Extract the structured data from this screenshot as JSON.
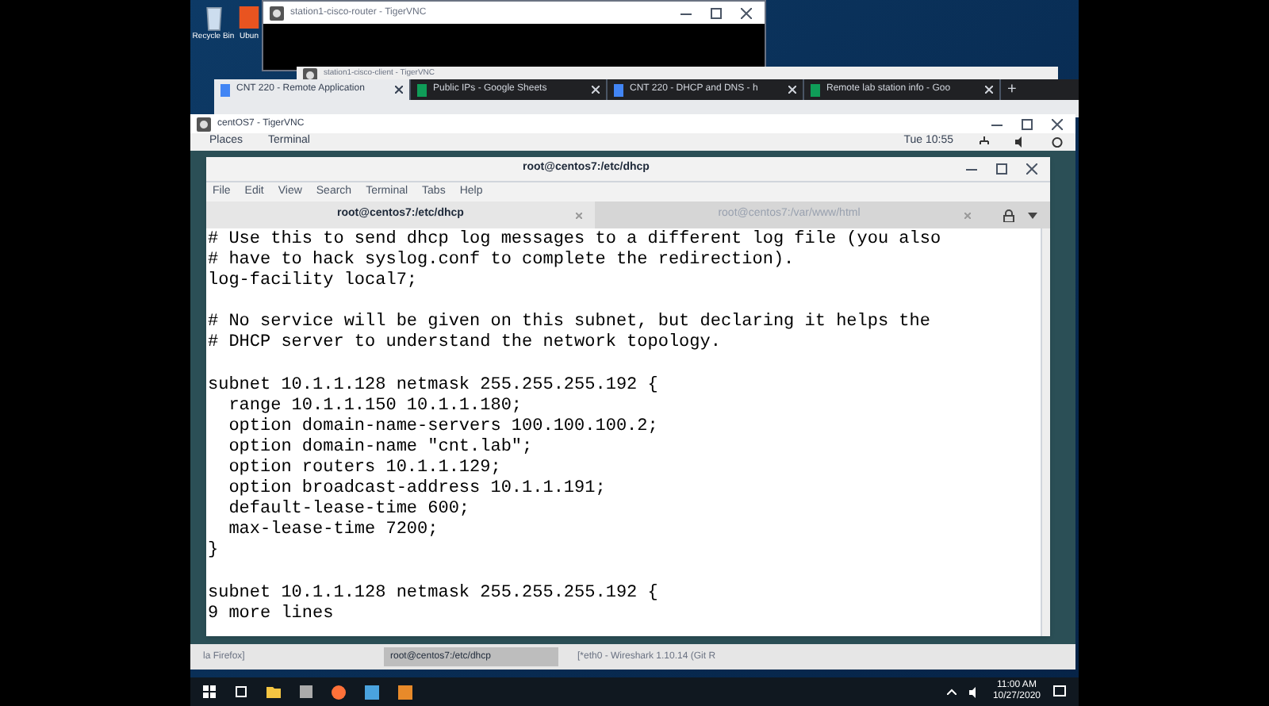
{
  "desktop_icons": [
    {
      "label": "Recycle Bin"
    },
    {
      "label": "Ubun"
    }
  ],
  "router_window": {
    "title": "station1-cisco-router - TigerVNC"
  },
  "client_window": {
    "title": "station1-cisco-client - TigerVNC"
  },
  "browser": {
    "tabs": [
      {
        "label": "CNT 220 - Remote Application",
        "kind": "doc",
        "selected": true
      },
      {
        "label": "Public IPs - Google Sheets",
        "kind": "sheet",
        "selected": false
      },
      {
        "label": "CNT 220 - DHCP and DNS - h",
        "kind": "doc",
        "selected": false
      },
      {
        "label": "Remote lab station info - Goo",
        "kind": "sheet",
        "selected": false
      }
    ],
    "new_tab": "+"
  },
  "vnc_window": {
    "title": "centOS7 - TigerVNC"
  },
  "gnome_bar": {
    "menus": [
      "Places",
      "Terminal"
    ],
    "clock": "Tue 10:55"
  },
  "terminal": {
    "title": "root@centos7:/etc/dhcp",
    "menu": [
      "File",
      "Edit",
      "View",
      "Search",
      "Terminal",
      "Tabs",
      "Help"
    ],
    "tabs": [
      {
        "label": "root@centos7:/etc/dhcp",
        "selected": true
      },
      {
        "label": "root@centos7:/var/www/html",
        "selected": false
      }
    ],
    "blocks": [
      [
        "# Use this to send dhcp log messages to a different log file (you also",
        "# have to hack syslog.conf to complete the redirection).",
        "log-facility local7;"
      ],
      [
        "# No service will be given on this subnet, but declaring it helps the",
        "# DHCP server to understand the network topology."
      ],
      [
        "subnet 10.1.1.128 netmask 255.255.255.192 {",
        "  range 10.1.1.150 10.1.1.180;",
        "  option domain-name-servers 100.100.100.2;",
        "  option domain-name \"cnt.lab\";",
        "  option routers 10.1.1.129;",
        "  option broadcast-address 10.1.1.191;",
        "  default-lease-time 600;",
        "  max-lease-time 7200;",
        "}"
      ],
      [
        "subnet 10.1.1.128 netmask 255.255.255.192 {",
        "9 more lines"
      ]
    ]
  },
  "gnome_taskbar": [
    {
      "label": "la Firefox]",
      "selected": false
    },
    {
      "label": "root@centos7:/etc/dhcp",
      "selected": true
    },
    {
      "label": "[*eth0 - Wireshark 1.10.14 (Git R",
      "selected": false
    }
  ],
  "taskbar": {
    "time": "11:00 AM",
    "date": "10/27/2020"
  }
}
